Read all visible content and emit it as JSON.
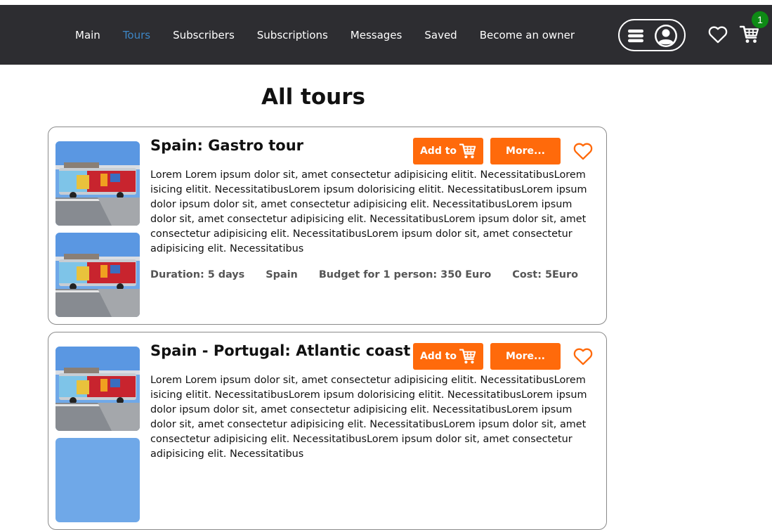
{
  "nav": {
    "links": [
      {
        "label": "Main"
      },
      {
        "label": "Tours",
        "active": true
      },
      {
        "label": "Subscribers"
      },
      {
        "label": "Subscriptions"
      },
      {
        "label": "Messages"
      },
      {
        "label": "Saved"
      },
      {
        "label": "Become an owner"
      }
    ],
    "cart_count": "1",
    "icons": [
      "menu-icon",
      "user-icon",
      "heart-icon",
      "cart-icon"
    ]
  },
  "page": {
    "title": "All tours"
  },
  "tours": [
    {
      "title": "Spain: Gastro tour",
      "add_label": "Add to",
      "more_label": "More...",
      "description": "Lorem Lorem ipsum dolor sit, amet consectetur adipisicing elitit. NecessitatibusLorem isicing elitit. NecessitatibusLorem ipsum dolorisicing elitit. NecessitatibusLorem ipsum dolor ipsum dolor sit, amet consectetur adipisicing elit. NecessitatibusLorem ipsum dolor sit, amet consectetur adipisicing elit. NecessitatibusLorem ipsum dolor sit, amet consectetur adipisicing elit. NecessitatibusLorem ipsum dolor sit, amet consectetur adipisicing elit. Necessitatibus",
      "duration": "Duration: 5 days",
      "country": "Spain",
      "budget": "Budget for 1 person: 350 Euro",
      "cost": "Cost: 5Euro"
    },
    {
      "title": "Spain - Portugal: Atlantic coast",
      "add_label": "Add to",
      "more_label": "More...",
      "description": "Lorem Lorem ipsum dolor sit, amet consectetur adipisicing elitit. NecessitatibusLorem isicing elitit. NecessitatibusLorem ipsum dolorisicing elitit. NecessitatibusLorem ipsum dolor ipsum dolor sit, amet consectetur adipisicing elit. NecessitatibusLorem ipsum dolor sit, amet consectetur adipisicing elit. NecessitatibusLorem ipsum dolor sit, amet consectetur adipisicing elit. NecessitatibusLorem ipsum dolor sit, amet consectetur adipisicing elit. Necessitatibus",
      "duration": "",
      "country": "",
      "budget": "",
      "cost": ""
    }
  ],
  "colors": {
    "navbar_bg": "#2d2d31",
    "nav_active": "#3d86c6",
    "accent_orange": "#ff6a0b",
    "badge_green": "#0e8a15",
    "meta_gray": "#555555"
  }
}
